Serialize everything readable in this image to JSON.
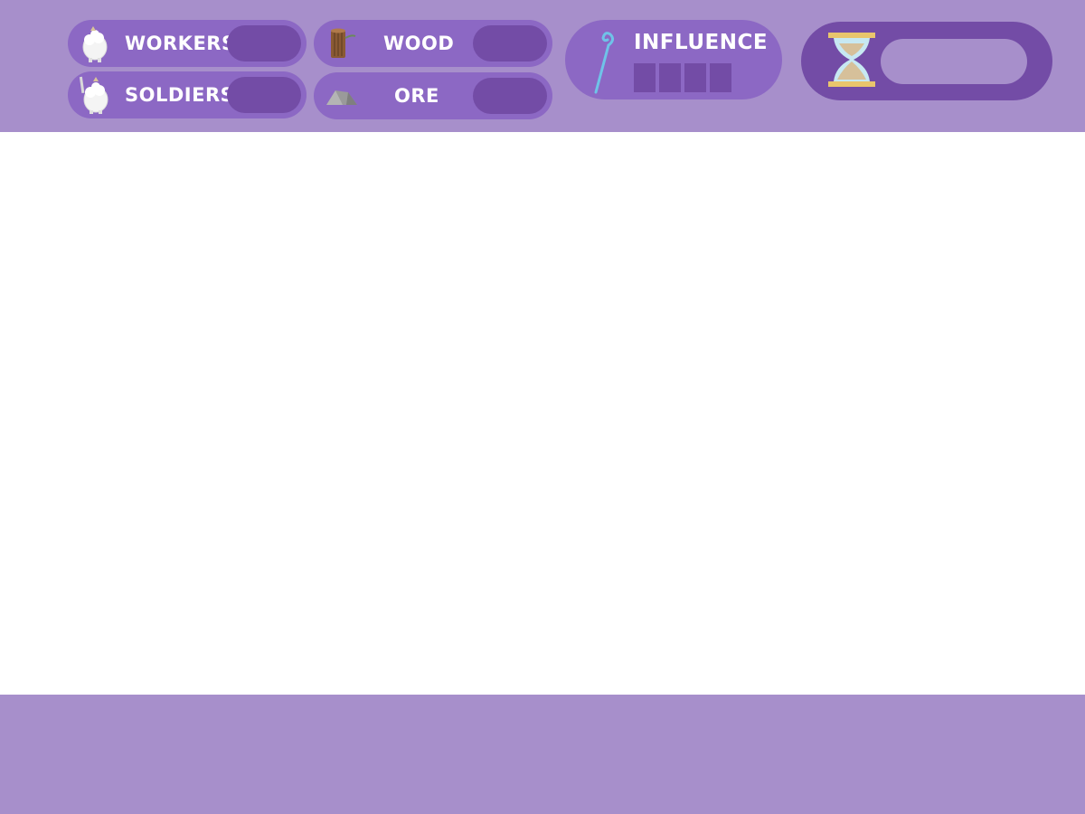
{
  "resources": {
    "workers": {
      "label": "WORKERS",
      "icon": "sheep-worker-icon"
    },
    "soldiers": {
      "label": "SOLDIERS",
      "icon": "sheep-soldier-icon"
    },
    "wood": {
      "label": "WOOD",
      "icon": "log-icon"
    },
    "ore": {
      "label": "ORE",
      "icon": "rock-icon"
    }
  },
  "influence": {
    "label": "INFLUENCE",
    "icon": "staff-icon",
    "slots_total": 4,
    "slots_filled": 0
  },
  "timer": {
    "icon": "hourglass-icon",
    "progress": 0
  },
  "colors": {
    "bar_background": "#a78fcb",
    "pill": "#8c68c4",
    "value_box": "#734ca6",
    "text": "#ffffff"
  }
}
